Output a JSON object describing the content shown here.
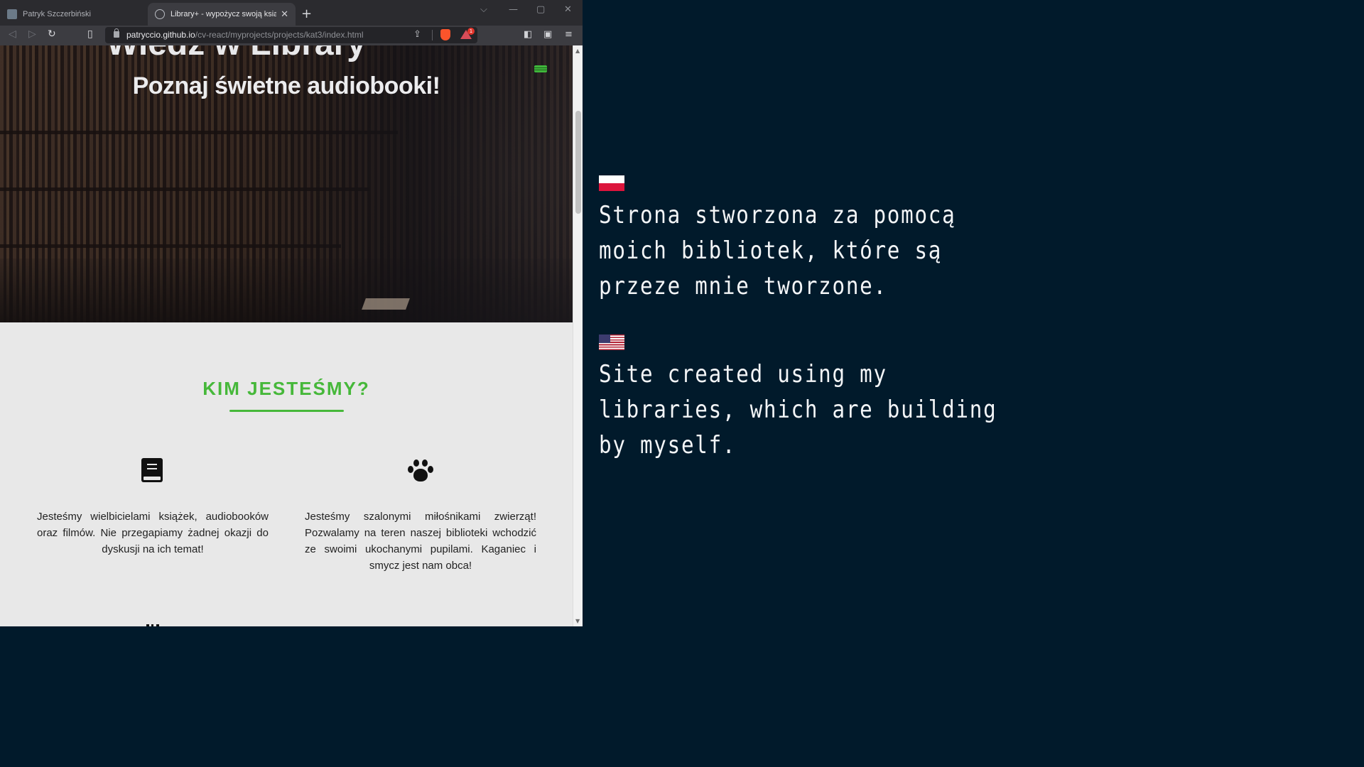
{
  "browser": {
    "tabs": [
      {
        "title": "Patryk Szczerbiński",
        "active": false
      },
      {
        "title": "Library+ - wypożycz swoją książk",
        "active": true
      }
    ],
    "url_host": "patryccio.github.io",
    "url_path": "/cv-react/myprojects/projects/kat3/index.html",
    "rewards_badge": "1"
  },
  "page": {
    "hero_title": "Wiedz w Library",
    "hero_subtitle": "Poznaj świetne audiobooki!",
    "about_title": "KIM JESTEŚMY?",
    "features": [
      {
        "icon": "book-icon",
        "text": "Jesteśmy wielbicielami książek, audiobooków oraz filmów. Nie przegapiamy żadnej okazji do dyskusji na ich temat!"
      },
      {
        "icon": "paw-icon",
        "text": "Jesteśmy szalonymi miłośnikami zwierząt! Pozwalamy na teren naszej biblioteki wchodzić ze swoimi ukochanymi pupilami. Kaganiec i smycz jest nam obca!"
      }
    ],
    "accent_color": "#46b83a"
  },
  "caption": {
    "pl_text": "Strona stworzona za pomocą moich bibliotek, które są przeze mnie tworzone.",
    "en_text": "Site created using my libraries, which are building by myself.",
    "background_color": "#011a2b"
  }
}
